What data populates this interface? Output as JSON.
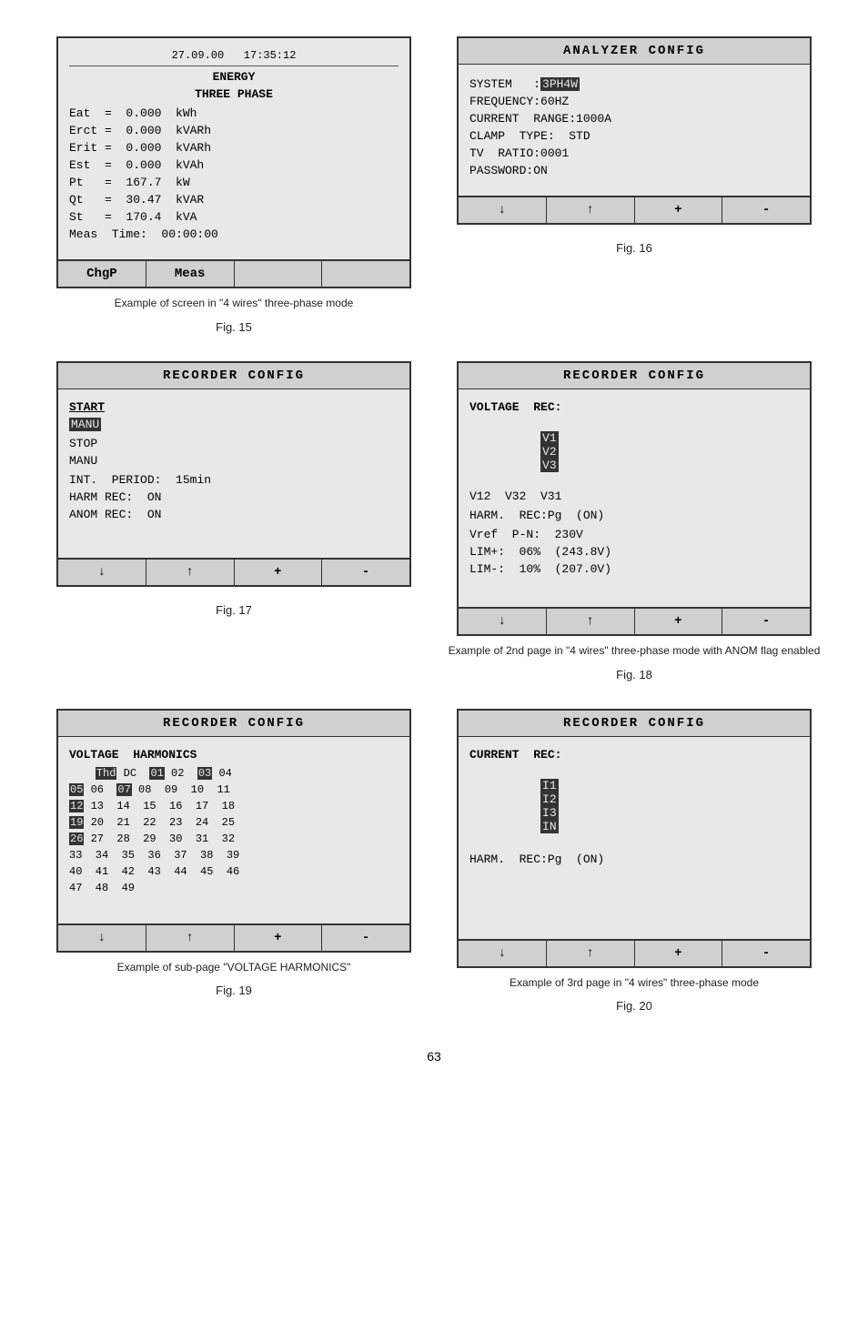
{
  "figures": {
    "fig15": {
      "label": "Fig. 15",
      "caption": "Example of screen in \"4 wires\"\nthree-phase mode",
      "screen": {
        "header": "27.09.00   17:35:12",
        "title_line1": "ENERGY",
        "title_line2": "THREE PHASE",
        "rows": [
          "Eat  =  0.000  kWh",
          "Erct =  0.000  kVARh",
          "Erit =  0.000  kVARh",
          "Est  =  0.000  kVAh",
          "Pt   =  167.7  kW",
          "Qt   =  30.47  kVAR",
          "St   =  170.4  kVA",
          "Meas  Time:  00:00:00"
        ],
        "buttons": [
          "ChgP",
          "Meas",
          "",
          ""
        ]
      }
    },
    "fig16": {
      "label": "Fig. 16",
      "caption": "",
      "screen": {
        "title": "ANALYZER  CONFIG",
        "rows": [
          "SYSTEM   :3PH4W",
          "FREQUENCY:60HZ",
          "CURRENT  RANGE:1000A",
          "CLAMP  TYPE:  STD",
          "TV  RATIO:0001",
          "PASSWORD:ON"
        ],
        "buttons": [
          "↓",
          "↑",
          "+",
          "-"
        ]
      }
    },
    "fig17": {
      "label": "Fig. 17",
      "caption": "",
      "screen": {
        "title": "RECORDER  CONFIG",
        "rows": [
          {
            "text": "START",
            "bold": true
          },
          {
            "text": "MANU",
            "inv": true
          },
          "",
          {
            "text": "STOP",
            "bold": false
          },
          {
            "text": "MANU",
            "bold": false
          },
          "",
          {
            "text": "INT.  PERIOD:  15min",
            "bold": false
          },
          {
            "text": "HARM REC:  ON",
            "bold": false
          },
          {
            "text": "ANOM REC:  ON",
            "bold": false
          }
        ],
        "buttons": [
          "↓",
          "↑",
          "+",
          "-"
        ]
      }
    },
    "fig18": {
      "label": "Fig. 18",
      "caption": "Example of 2nd page in \"4 wires\"\nthree-phase mode with ANOM\nflag enabled",
      "screen": {
        "title": "RECORDER  CONFIG",
        "rows": [
          "VOLTAGE  REC:",
          "V1   V2   V3",
          "V12  V32  V31",
          "",
          "HARM.  REC:Pg  (ON)",
          "",
          "Vref  P-N:  230V",
          "LIM+:  06%  (243.8V)",
          "LIM-:  10%  (207.0V)"
        ],
        "buttons": [
          "↓",
          "↑",
          "+",
          "-"
        ],
        "voltage_highlight": [
          "V1",
          "V2",
          "V3"
        ]
      }
    },
    "fig19": {
      "label": "Fig. 19",
      "caption": "Example of sub-page\n\"VOLTAGE HARMONICS\"",
      "screen": {
        "title": "RECORDER  CONFIG",
        "subtitle": "VOLTAGE  HARMONICS",
        "harm_rows": [
          {
            "prefix_inv": "",
            "cells": [
              "Thd",
              "DC",
              "01",
              "02",
              "03",
              "04"
            ],
            "inv_cells": [
              "Thd"
            ]
          },
          {
            "prefix_inv": "05",
            "cells": [
              "06",
              "07",
              "08",
              "09",
              "10",
              "11"
            ],
            "inv_cells": []
          },
          {
            "prefix_inv": "12",
            "cells": [
              "13",
              "14",
              "15",
              "16",
              "17",
              "18"
            ],
            "inv_cells": []
          },
          {
            "prefix_inv": "19",
            "cells": [
              "20",
              "21",
              "22",
              "23",
              "24",
              "25"
            ],
            "inv_cells": []
          },
          {
            "prefix_inv": "26",
            "cells": [
              "27",
              "28",
              "29",
              "30",
              "31",
              "32"
            ],
            "inv_cells": []
          },
          {
            "prefix_inv": "33",
            "cells": [
              "34",
              "35",
              "36",
              "37",
              "38",
              "39"
            ],
            "inv_cells": []
          },
          {
            "prefix_inv": "40",
            "cells": [
              "41",
              "42",
              "43",
              "44",
              "45",
              "46"
            ],
            "inv_cells": []
          },
          {
            "prefix_inv": "47",
            "cells": [
              "48",
              "49"
            ],
            "inv_cells": []
          }
        ],
        "buttons": [
          "↓",
          "↑",
          "+",
          "-"
        ]
      }
    },
    "fig20": {
      "label": "Fig. 20",
      "caption": "Example of 3rd page in \"4 wires\"\nthree-phase mode",
      "screen": {
        "title": "RECORDER  CONFIG",
        "rows": [
          "CURRENT  REC:",
          "I1   I2   I3   IN",
          "",
          "HARM.  REC:Pg  (ON)"
        ],
        "buttons": [
          "↓",
          "↑",
          "+",
          "-"
        ],
        "current_highlight": [
          "I1",
          "I2",
          "I3",
          "IN"
        ]
      }
    }
  },
  "page_number": "63"
}
